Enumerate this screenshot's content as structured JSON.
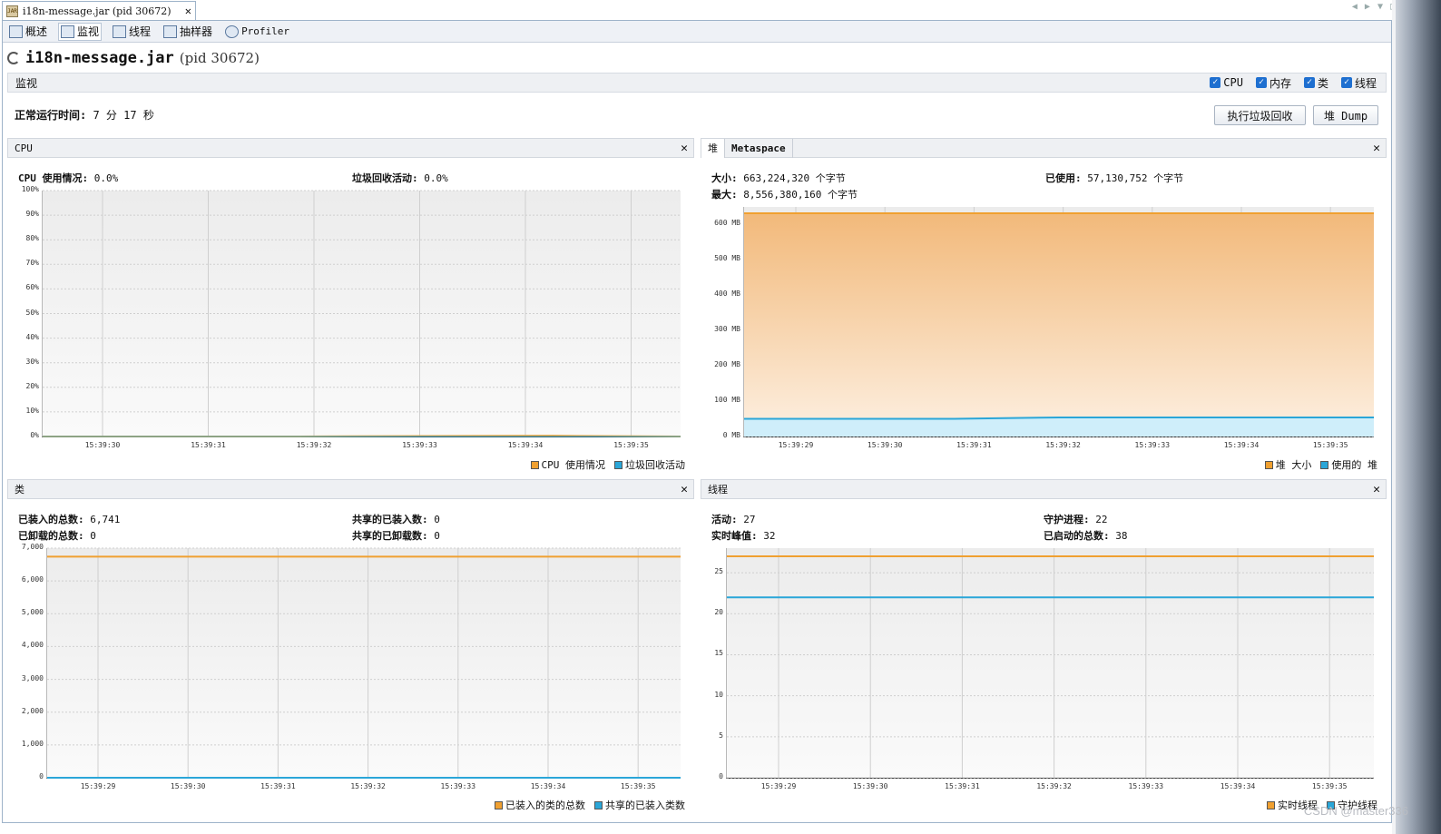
{
  "editor_tab": {
    "icon": "jar-icon",
    "title": "i18n-message.jar (pid 30672)",
    "close": "✕"
  },
  "window_controls": [
    "◀",
    "▶",
    "▼",
    "□"
  ],
  "subtabs": [
    {
      "label": "概述",
      "icon": "overview-icon"
    },
    {
      "label": "监视",
      "icon": "monitor-icon"
    },
    {
      "label": "线程",
      "icon": "threads-icon"
    },
    {
      "label": "抽样器",
      "icon": "sampler-icon"
    },
    {
      "label": "Profiler",
      "icon": "profiler-icon"
    }
  ],
  "header": {
    "app": "i18n-message.jar",
    "pid": "(pid 30672)"
  },
  "monitor": {
    "title": "监视",
    "checks": [
      {
        "label": "CPU",
        "checked": true
      },
      {
        "label": "内存",
        "checked": true
      },
      {
        "label": "类",
        "checked": true
      },
      {
        "label": "线程",
        "checked": true
      }
    ],
    "uptime_key": "正常运行时间:",
    "uptime_value": "7 分 17 秒",
    "gc_button": "执行垃圾回收",
    "dump_button": "堆 Dump"
  },
  "cpu_panel": {
    "title": "CPU",
    "stat_cpu_key": "CPU 使用情况:",
    "stat_cpu_val": "0.0%",
    "stat_gc_key": "垃圾回收活动:",
    "stat_gc_val": "0.0%",
    "legend": [
      "CPU 使用情况",
      "垃圾回收活动"
    ]
  },
  "heap_panel": {
    "tabs": [
      "堆",
      "Metaspace"
    ],
    "size_key": "大小:",
    "size_val": "663,224,320 个字节",
    "max_key": "最大:",
    "max_val": "8,556,380,160 个字节",
    "used_key": "已使用:",
    "used_val": "57,130,752 个字节",
    "legend": [
      "堆 大小",
      "使用的 堆"
    ]
  },
  "classes_panel": {
    "title": "类",
    "loaded_key": "已装入的总数:",
    "loaded_val": "6,741",
    "unloaded_key": "已卸载的总数:",
    "unloaded_val": "0",
    "shared_loaded_key": "共享的已装入数:",
    "shared_loaded_val": "0",
    "shared_unloaded_key": "共享的已卸载数:",
    "shared_unloaded_val": "0",
    "legend": [
      "已装入的类的总数",
      "共享的已装入类数"
    ]
  },
  "threads_panel": {
    "title": "线程",
    "live_key": "活动:",
    "live_val": "27",
    "peak_key": "实时峰值:",
    "peak_val": "32",
    "daemon_key": "守护进程:",
    "daemon_val": "22",
    "started_key": "已启动的总数:",
    "started_val": "38",
    "legend": [
      "实时线程",
      "守护线程"
    ]
  },
  "colors": {
    "orange": "#f0a030",
    "blue": "#2aa6d8",
    "heap_fill_top": "#f2b97a",
    "heap_fill_bottom": "#fdf0e2",
    "used_fill": "#cfeefa"
  },
  "chart_data": [
    {
      "type": "line",
      "name": "cpu",
      "x": [
        "15:39:30",
        "15:39:31",
        "15:39:32",
        "15:39:33",
        "15:39:34",
        "15:39:35"
      ],
      "yticks": [
        "0%",
        "10%",
        "20%",
        "30%",
        "40%",
        "50%",
        "60%",
        "70%",
        "80%",
        "90%",
        "100%"
      ],
      "ylim": [
        0,
        100
      ],
      "series": [
        {
          "name": "CPU 使用情况",
          "values": [
            0,
            0,
            0,
            0.2,
            0.3,
            0
          ]
        },
        {
          "name": "垃圾回收活动",
          "values": [
            0,
            0,
            0,
            0,
            0,
            0
          ]
        }
      ]
    },
    {
      "type": "area",
      "name": "heap",
      "x": [
        "15:39:29",
        "15:39:30",
        "15:39:31",
        "15:39:32",
        "15:39:33",
        "15:39:34",
        "15:39:35"
      ],
      "yticks": [
        "0 MB",
        "100 MB",
        "200 MB",
        "300 MB",
        "400 MB",
        "500 MB",
        "600 MB"
      ],
      "ylim": [
        0,
        650
      ],
      "series": [
        {
          "name": "堆 大小",
          "values": [
            632,
            632,
            632,
            632,
            632,
            632,
            632
          ]
        },
        {
          "name": "使用的 堆",
          "values": [
            50,
            50,
            50,
            54,
            54,
            54,
            54
          ]
        }
      ]
    },
    {
      "type": "line",
      "name": "classes",
      "x": [
        "15:39:29",
        "15:39:30",
        "15:39:31",
        "15:39:32",
        "15:39:33",
        "15:39:34",
        "15:39:35"
      ],
      "yticks": [
        "0",
        "1,000",
        "2,000",
        "3,000",
        "4,000",
        "5,000",
        "6,000",
        "7,000"
      ],
      "ylim": [
        0,
        7000
      ],
      "series": [
        {
          "name": "已装入的类的总数",
          "values": [
            6741,
            6741,
            6741,
            6741,
            6741,
            6741,
            6741
          ]
        },
        {
          "name": "共享的已装入类数",
          "values": [
            0,
            0,
            0,
            0,
            0,
            0,
            0
          ]
        }
      ]
    },
    {
      "type": "line",
      "name": "threads",
      "x": [
        "15:39:29",
        "15:39:30",
        "15:39:31",
        "15:39:32",
        "15:39:33",
        "15:39:34",
        "15:39:35"
      ],
      "yticks": [
        "0",
        "5",
        "10",
        "15",
        "20",
        "25"
      ],
      "ylim": [
        0,
        28
      ],
      "series": [
        {
          "name": "实时线程",
          "values": [
            27,
            27,
            27,
            27,
            27,
            27,
            27
          ]
        },
        {
          "name": "守护线程",
          "values": [
            22,
            22,
            22,
            22,
            22,
            22,
            22
          ]
        }
      ]
    }
  ],
  "watermark": "CSDN @master336"
}
